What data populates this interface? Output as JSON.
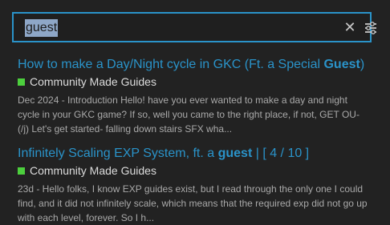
{
  "search": {
    "value": "guest"
  },
  "icons": {
    "clear": "close-icon",
    "filter": "sliders-icon"
  },
  "colors": {
    "accent": "#2a93c9",
    "category": "#4ccf3d",
    "selection": "#8ea7c7"
  },
  "results": [
    {
      "title_before": "How to make a Day/Night cycle in GKC (Ft. a Special ",
      "title_highlight": "Guest",
      "title_after": ")",
      "category": "Community Made Guides",
      "excerpt": "Dec 2024 - Introduction Hello! have you ever wanted to make a day and night cycle in your GKC game? If so, well you came to the right place, if not, GET OU- (/j) Let's get started- falling down stairs SFX wha..."
    },
    {
      "title_before": "Infinitely Scaling EXP System, ft. a ",
      "title_highlight": "guest",
      "title_after": " | [ 4 / 10 ]",
      "category": "Community Made Guides",
      "excerpt": "23d - Hello folks, I know EXP guides exist, but I read through the only one I could find, and it did not infinitely scale, which means that the required exp did not go up with each level, forever. So I h..."
    }
  ]
}
